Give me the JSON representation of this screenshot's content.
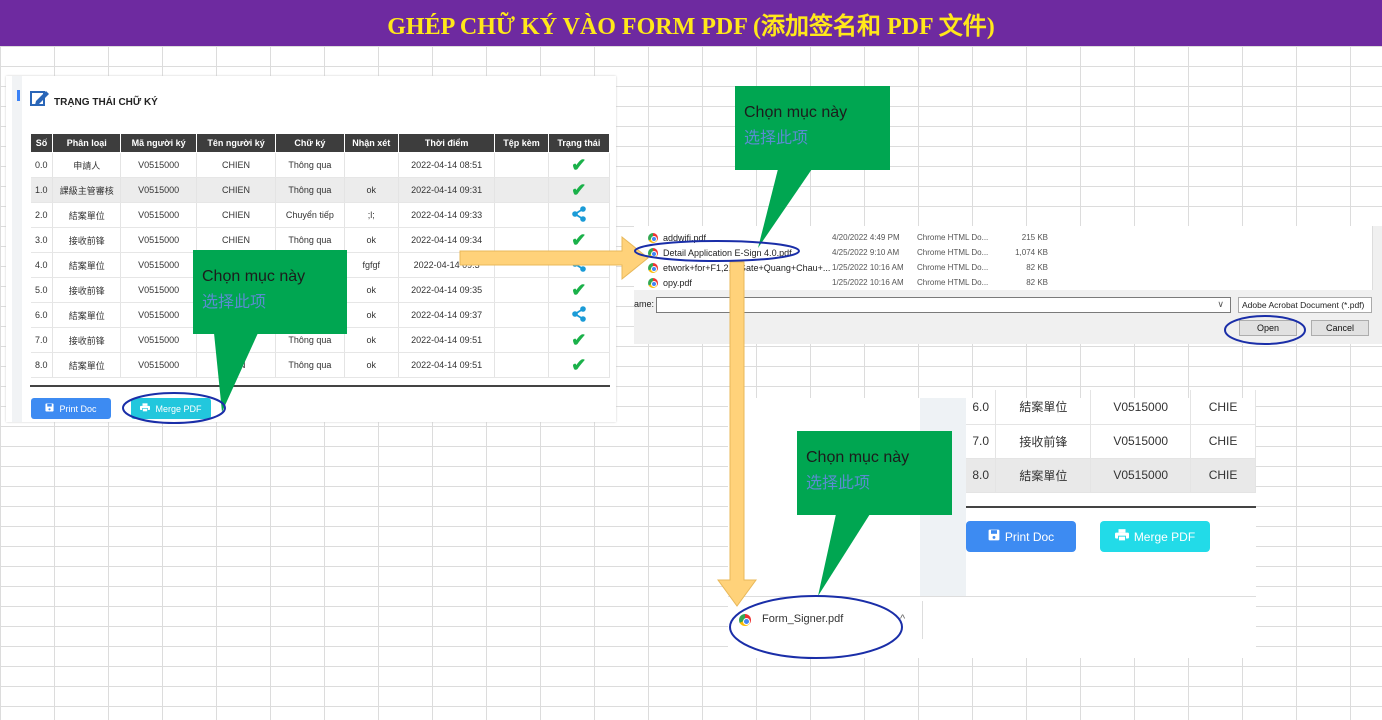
{
  "banner": {
    "title": "GHÉP CHỮ KÝ VÀO FORM PDF (添加签名和 PDF 文件)"
  },
  "panel1": {
    "header": "TRẠNG THÁI CHỮ KÝ",
    "columns": [
      "Số",
      "Phân loại",
      "Mã người ký",
      "Tên người ký",
      "Chữ ký",
      "Nhận xét",
      "Thời điểm",
      "Tệp kèm",
      "Trạng thái"
    ],
    "rows": [
      {
        "no": "0.0",
        "type": "申請人",
        "code": "V0515000",
        "name": "CHIEN",
        "sign": "Thông qua",
        "note": "",
        "time": "2022-04-14 08:51",
        "status": "check"
      },
      {
        "no": "1.0",
        "type": "課級主管審核",
        "code": "V0515000",
        "name": "CHIEN",
        "sign": "Thông qua",
        "note": "ok",
        "time": "2022-04-14 09:31",
        "status": "check"
      },
      {
        "no": "2.0",
        "type": "結案單位",
        "code": "V0515000",
        "name": "CHIEN",
        "sign": "Chuyển tiếp",
        "note": ";l;",
        "time": "2022-04-14 09:33",
        "status": "share"
      },
      {
        "no": "3.0",
        "type": "接收前锋",
        "code": "V0515000",
        "name": "CHIEN",
        "sign": "Thông qua",
        "note": "ok",
        "time": "2022-04-14 09:34",
        "status": "check"
      },
      {
        "no": "4.0",
        "type": "結案單位",
        "code": "V0515000",
        "name": "",
        "sign": "",
        "note": "fgfgf",
        "time": "2022-04-14 09:3",
        "status": "share"
      },
      {
        "no": "5.0",
        "type": "接收前锋",
        "code": "V0515000",
        "name": "",
        "sign": "",
        "note": "ok",
        "time": "2022-04-14 09:35",
        "status": "check"
      },
      {
        "no": "6.0",
        "type": "結案單位",
        "code": "V0515000",
        "name": "",
        "sign": "",
        "note": "ok",
        "time": "2022-04-14 09:37",
        "status": "share"
      },
      {
        "no": "7.0",
        "type": "接收前锋",
        "code": "V0515000",
        "name": "",
        "sign": "Thông qua",
        "note": "ok",
        "time": "2022-04-14 09:51",
        "status": "check"
      },
      {
        "no": "8.0",
        "type": "結案單位",
        "code": "V0515000",
        "name": "NEN",
        "sign": "Thông qua",
        "note": "ok",
        "time": "2022-04-14 09:51",
        "status": "check"
      }
    ],
    "print_btn": "Print Doc",
    "merge_btn": "Merge PDF"
  },
  "callouts": [
    {
      "vi": "Chọn mục này",
      "zh": "选择此项"
    },
    {
      "vi": "Chọn mục này",
      "zh": "选择此项"
    },
    {
      "vi": "Chọn mục này",
      "zh": "选择此项"
    }
  ],
  "dialog": {
    "files": [
      {
        "name": "addwifi.pdf",
        "date": "4/20/2022 4:49 PM",
        "type": "Chrome HTML Do...",
        "size": "215 KB"
      },
      {
        "name": "Detail Application E-Sign 4.0.pdf",
        "date": "4/25/2022 9:10 AM",
        "type": "Chrome HTML Do...",
        "size": "1,074 KB"
      },
      {
        "name": "etwork+for+F1,2,1-Gate+Quang+Chau+...",
        "date": "1/25/2022 10:16 AM",
        "type": "Chrome HTML Do...",
        "size": "82 KB"
      },
      {
        "name": "opy.pdf",
        "date": "1/25/2022 10:16 AM",
        "type": "Chrome HTML Do...",
        "size": "82 KB"
      }
    ],
    "name_label": "ame:",
    "name_value": "",
    "type_filter": "Adobe Acrobat Document (*.pdf)",
    "open_btn": "Open",
    "cancel_btn": "Cancel"
  },
  "panel3": {
    "rows": [
      {
        "no": "6.0",
        "type": "結案單位",
        "code": "V0515000",
        "name": "CHIE"
      },
      {
        "no": "7.0",
        "type": "接收前锋",
        "code": "V0515000",
        "name": "CHIE"
      },
      {
        "no": "8.0",
        "type": "結案單位",
        "code": "V0515000",
        "name": "CHIE"
      }
    ],
    "print_btn": "Print Doc",
    "merge_btn": "Merge PDF",
    "download_file": "Form_Signer.pdf"
  },
  "colors": {
    "banner_bg": "#6e2aa0",
    "banner_text": "#ffe81a",
    "callout_bg": "#00a651",
    "check": "#1bb14a",
    "share": "#1a9bd7",
    "print_btn": "#3d8bf2",
    "merge_btn": "#22c7dd",
    "arrow": "#ffd27a"
  }
}
